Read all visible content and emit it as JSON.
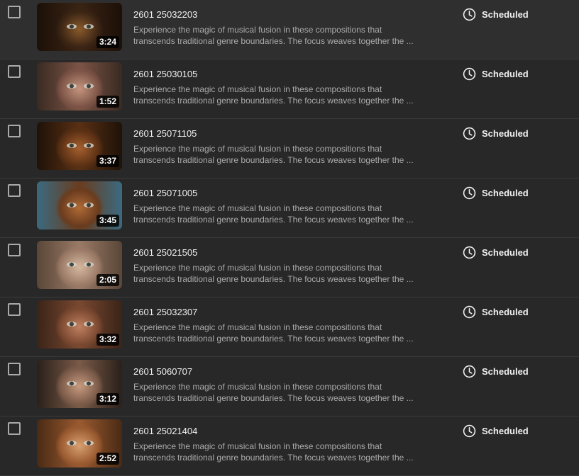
{
  "status": {
    "icon": "clock-icon"
  },
  "videos": [
    {
      "title": "2601 25032203",
      "description": "Experience the magic of musical fusion in these compositions that transcends traditional genre boundaries. The focus weaves together the ...",
      "duration": "3:24",
      "status": "Scheduled",
      "thumb_colors": [
        "#8a5a2c",
        "#3a2414",
        "#1c1008"
      ]
    },
    {
      "title": "2601 25030105",
      "description": "Experience the magic of musical fusion in these compositions that transcends traditional genre boundaries. The focus weaves together the ...",
      "duration": "1:52",
      "status": "Scheduled",
      "thumb_colors": [
        "#c49580",
        "#7c5446",
        "#3a2a22"
      ]
    },
    {
      "title": "2601 25071105",
      "description": "Experience the magic of musical fusion in these compositions that transcends traditional genre boundaries. The focus weaves together the ...",
      "duration": "3:37",
      "status": "Scheduled",
      "thumb_colors": [
        "#a55f2e",
        "#5a3014",
        "#1e1208"
      ]
    },
    {
      "title": "2601 25071005",
      "description": "Experience the magic of musical fusion in these compositions that transcends traditional genre boundaries. The focus weaves together the ...",
      "duration": "3:45",
      "status": "Scheduled",
      "thumb_colors": [
        "#b06a36",
        "#6a3c1e",
        "#3a6a80"
      ]
    },
    {
      "title": "2601 25021505",
      "description": "Experience the magic of musical fusion in these compositions that transcends traditional genre boundaries. The focus weaves together the ...",
      "duration": "2:05",
      "status": "Scheduled",
      "thumb_colors": [
        "#d6b8a0",
        "#9a7a66",
        "#5a4638"
      ]
    },
    {
      "title": "2601 25032307",
      "description": "Experience the magic of musical fusion in these compositions that transcends traditional genre boundaries. The focus weaves together the ...",
      "duration": "3:32",
      "status": "Scheduled",
      "thumb_colors": [
        "#c08060",
        "#7a4830",
        "#3a2418"
      ]
    },
    {
      "title": "2601 5060707",
      "description": "Experience the magic of musical fusion in these compositions that transcends traditional genre boundaries. The focus weaves together the ...",
      "duration": "3:12",
      "status": "Scheduled",
      "thumb_colors": [
        "#c89a80",
        "#7a5a48",
        "#2a201a"
      ]
    },
    {
      "title": "2601 25021404",
      "description": "Experience the magic of musical fusion in these compositions that transcends traditional genre boundaries. The focus weaves together the ...",
      "duration": "2:52",
      "status": "Scheduled",
      "thumb_colors": [
        "#d8a070",
        "#9a5a30",
        "#4a2a14"
      ]
    }
  ]
}
